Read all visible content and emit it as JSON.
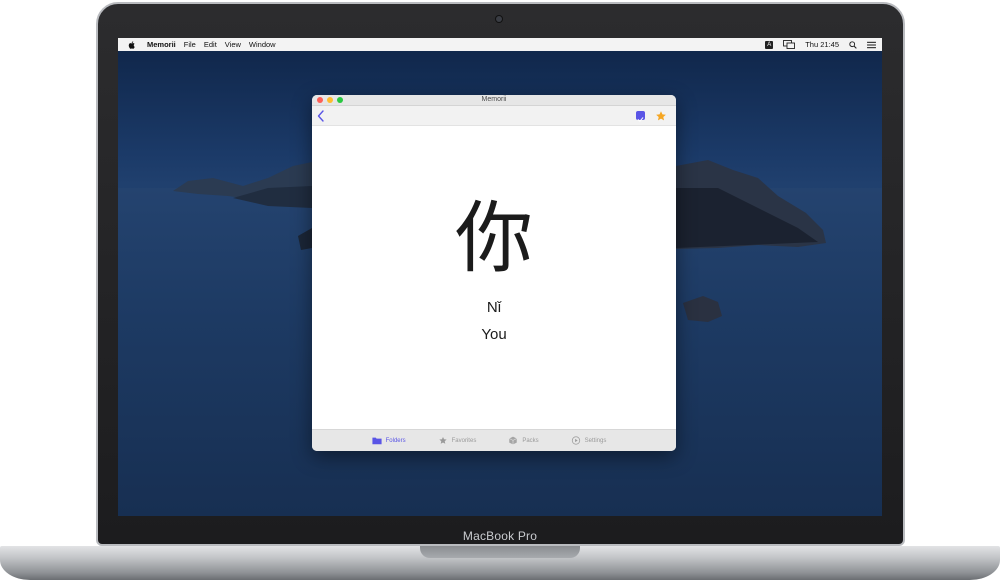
{
  "device": {
    "label": "MacBook Pro"
  },
  "menubar": {
    "items": [
      "Memorii",
      "File",
      "Edit",
      "View",
      "Window"
    ],
    "input_badge": "A",
    "clock": "Thu 21:45"
  },
  "window": {
    "title": "Memorii"
  },
  "card": {
    "character": "你",
    "pinyin": "Nǐ",
    "meaning": "You"
  },
  "tabs": [
    {
      "label": "Folders",
      "icon": "folder-icon",
      "active": true
    },
    {
      "label": "Favorites",
      "icon": "star-icon",
      "active": false
    },
    {
      "label": "Packs",
      "icon": "box-icon",
      "active": false
    },
    {
      "label": "Settings",
      "icon": "play-circle-icon",
      "active": false
    }
  ],
  "colors": {
    "accent": "#5a55e6",
    "favorite": "#f5a623",
    "tab_inactive": "#9a9a9a"
  }
}
